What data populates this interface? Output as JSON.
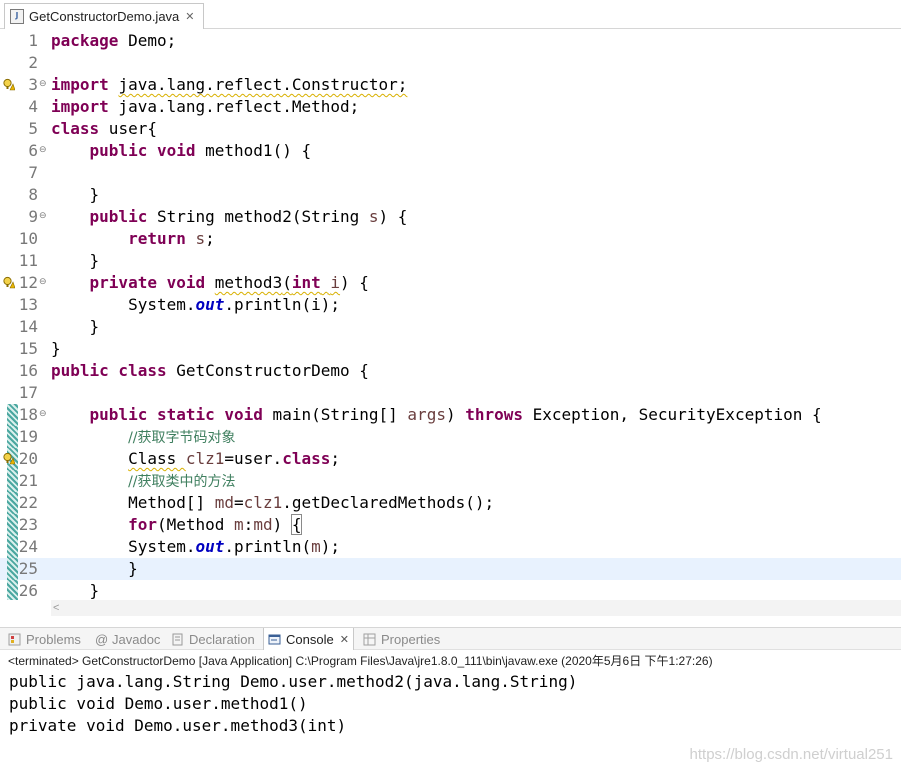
{
  "editor": {
    "tab_title": "GetConstructorDemo.java",
    "close_glyph": "✕",
    "current_line": 25,
    "lines": [
      {
        "n": "1"
      },
      {
        "n": "2"
      },
      {
        "n": "3"
      },
      {
        "n": "4"
      },
      {
        "n": "5"
      },
      {
        "n": "6"
      },
      {
        "n": "7"
      },
      {
        "n": "8"
      },
      {
        "n": "9"
      },
      {
        "n": "10"
      },
      {
        "n": "11"
      },
      {
        "n": "12"
      },
      {
        "n": "13"
      },
      {
        "n": "14"
      },
      {
        "n": "15"
      },
      {
        "n": "16"
      },
      {
        "n": "17"
      },
      {
        "n": "18"
      },
      {
        "n": "19"
      },
      {
        "n": "20"
      },
      {
        "n": "21"
      },
      {
        "n": "22"
      },
      {
        "n": "23"
      },
      {
        "n": "24"
      },
      {
        "n": "25"
      },
      {
        "n": "26"
      }
    ],
    "code": {
      "l1_kw": "package",
      "l1_rest": " Demo;",
      "l3_kw": "import",
      "l3_rest": "java.lang.reflect.Constructor;",
      "l4_kw": "import",
      "l4_rest": " java.lang.reflect.Method;",
      "l5_kw": "class",
      "l5_rest": " user{",
      "l6_kw": "public void",
      "l6_rest": " method1() {",
      "l8": "}",
      "l9_kw": "public",
      "l9_a": " String method2(String ",
      "l9_var": "s",
      "l9_b": ") {",
      "l10_kw": "return",
      "l10_var": " s",
      "l10_b": ";",
      "l11": "}",
      "l12_kw": "private void",
      "l12_name": "method3",
      "l12_p": "(",
      "l12_kw2": "int",
      "l12_var": "i",
      "l12_b": ") {",
      "l13_a": "System.",
      "l13_fld": "out",
      "l13_b": ".println(i);",
      "l14": "}",
      "l15": "}",
      "l16_kw": "public class",
      "l16_rest": " GetConstructorDemo {",
      "l18_kw": "public static void",
      "l18_a": " main(String[] ",
      "l18_var": "args",
      "l18_b": ") ",
      "l18_kw2": "throws",
      "l18_c": " Exception, SecurityException {",
      "l19": "//获取字节码对象",
      "l20_a": "Class ",
      "l20_var": "clz1",
      "l20_b": "=user.",
      "l20_kw": "class",
      "l20_c": ";",
      "l21": "//获取类中的方法",
      "l22_a": "Method[] ",
      "l22_var": "md",
      "l22_b": "=",
      "l22_var2": "clz1",
      "l22_c": ".getDeclaredMethods();",
      "l23_kw": "for",
      "l23_a": "(Method ",
      "l23_var": "m",
      "l23_b": ":",
      "l23_var2": "md",
      "l23_c": ") ",
      "l23_br": "{",
      "l24_a": "System.",
      "l24_fld": "out",
      "l24_b": ".println(",
      "l24_var": "m",
      "l24_c": ");",
      "l25": "}",
      "l26": "}"
    }
  },
  "views": {
    "tabs": [
      "Problems",
      "Javadoc",
      "Declaration",
      "Console",
      "Properties"
    ],
    "active": "Console"
  },
  "console": {
    "header": "<terminated> GetConstructorDemo [Java Application] C:\\Program Files\\Java\\jre1.8.0_111\\bin\\javaw.exe (2020年5月6日 下午1:27:26)",
    "output": [
      "public java.lang.String Demo.user.method2(java.lang.String)",
      "public void Demo.user.method1()",
      "private void Demo.user.method3(int)"
    ]
  },
  "watermark": "https://blog.csdn.net/virtual251",
  "colors": {
    "keyword": "#7f0055",
    "comment": "#3f7f5f",
    "field": "#0000c0",
    "variable": "#6a3e3e",
    "current_line": "#e8f2fe"
  }
}
